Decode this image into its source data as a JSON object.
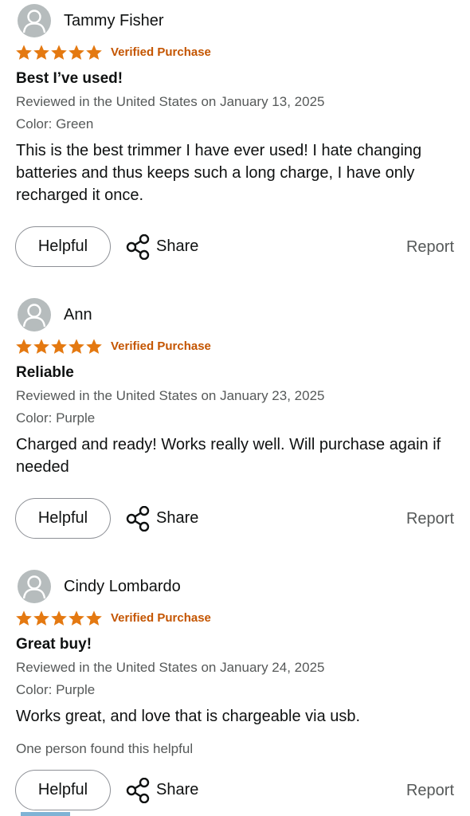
{
  "reviews": [
    {
      "author": "Tammy Fisher",
      "rating": 5,
      "verified_label": "Verified Purchase",
      "title": "Best I’ve used!",
      "reviewed_line": "Reviewed in the United States on January 13, 2025",
      "color_line": "Color: Green",
      "body": "This is the best trimmer I have ever used! I hate changing batteries and thus keeps such a long charge, I have only recharged it once.",
      "helpful_count_text": "",
      "helpful_label": "Helpful",
      "share_label": "Share",
      "report_label": "Report"
    },
    {
      "author": "Ann",
      "rating": 5,
      "verified_label": "Verified Purchase",
      "title": "Reliable",
      "reviewed_line": "Reviewed in the United States on January 23, 2025",
      "color_line": "Color: Purple",
      "body": "Charged and ready! Works really well. Will purchase again if needed",
      "helpful_count_text": "",
      "helpful_label": "Helpful",
      "share_label": "Share",
      "report_label": "Report"
    },
    {
      "author": "Cindy Lombardo",
      "rating": 5,
      "verified_label": "Verified Purchase",
      "title": "Great buy!",
      "reviewed_line": "Reviewed in the United States on January 24, 2025",
      "color_line": "Color: Purple",
      "body": "Works great, and love that is chargeable via usb.",
      "helpful_count_text": "One person found this helpful",
      "helpful_label": "Helpful",
      "share_label": "Share",
      "report_label": "Report"
    }
  ],
  "colors": {
    "star": "#e47911",
    "verified": "#c45500",
    "secondary_text": "#565959",
    "avatar_bg": "#b6bcbd"
  },
  "icons": {
    "avatar": "person-silhouette-icon",
    "star": "star-icon",
    "share": "share-icon"
  }
}
